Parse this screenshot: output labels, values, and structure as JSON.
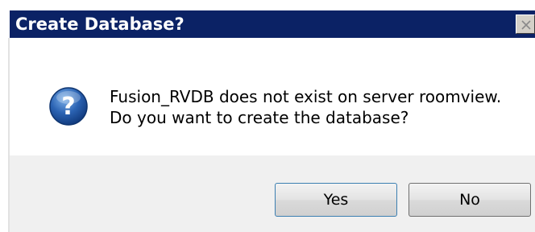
{
  "window": {
    "title": "Create Database?",
    "close_icon": "close-icon"
  },
  "message": {
    "icon": "question-icon",
    "line1": "Fusion_RVDB does not exist on server roomview.",
    "line2": "Do you want to create the database?"
  },
  "buttons": {
    "yes_label": "Yes",
    "no_label": "No"
  },
  "colors": {
    "titlebar": "#0b2265",
    "button_bar": "#f0f0f0",
    "icon_blue": "#2b63b3"
  }
}
